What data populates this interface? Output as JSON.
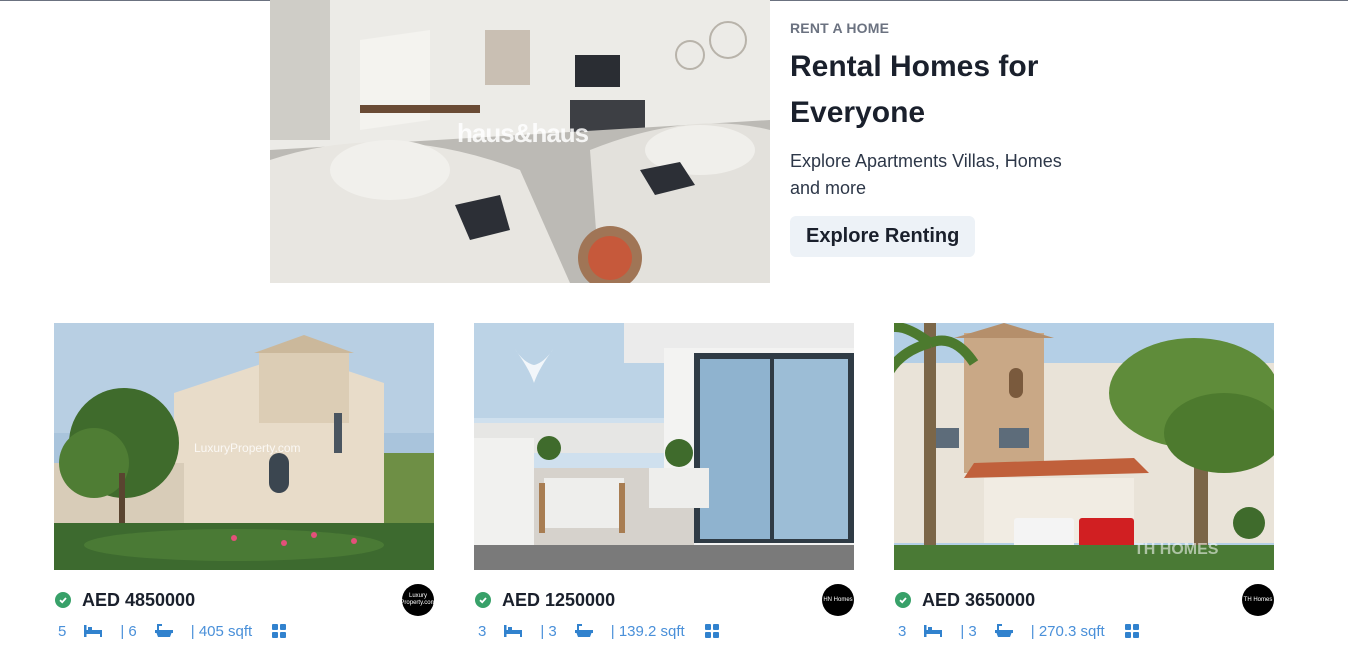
{
  "hero": {
    "eyebrow": "RENT A HOME",
    "title": "Rental Homes for Everyone",
    "description": "Explore Apartments Villas, Homes and more",
    "cta": "Explore Renting",
    "image_watermark": "haus&haus"
  },
  "listings": [
    {
      "price": "AED 4850000",
      "beds": "5",
      "baths": "| 6",
      "area": "| 405 sqft",
      "agency": "Luxury Property.com",
      "watermark": "LuxuryProperty.com"
    },
    {
      "price": "AED 1250000",
      "beds": "3",
      "baths": "| 3",
      "area": "| 139.2 sqft",
      "agency": "HN Homes",
      "watermark": ""
    },
    {
      "price": "AED 3650000",
      "beds": "3",
      "baths": "| 3",
      "area": "| 270.3 sqft",
      "agency": "TH Homes",
      "watermark": "TH HOMES"
    }
  ],
  "colors": {
    "accent": "#4a90d9",
    "verified": "#38a169",
    "button_bg": "#edf2f7"
  }
}
